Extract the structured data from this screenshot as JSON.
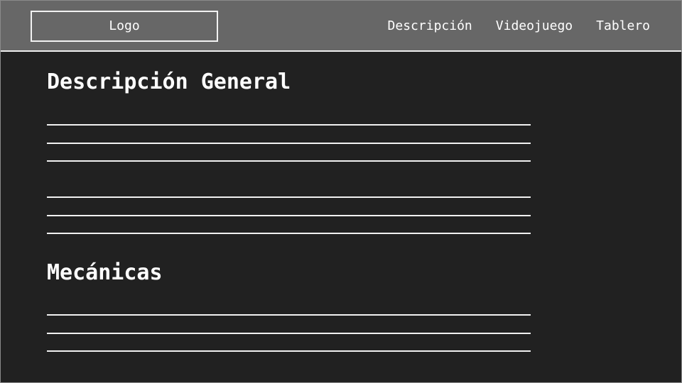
{
  "header": {
    "logo_label": "Logo",
    "nav": [
      "Descripción",
      "Videojuego",
      "Tablero"
    ]
  },
  "main": {
    "sections": [
      {
        "title": "Descripción General",
        "placeholder_lines": 6
      },
      {
        "title": "Mecánicas",
        "placeholder_lines": 3
      }
    ]
  },
  "colors": {
    "header_bg": "#676767",
    "page_bg": "#212121",
    "foreground": "#ffffff"
  }
}
